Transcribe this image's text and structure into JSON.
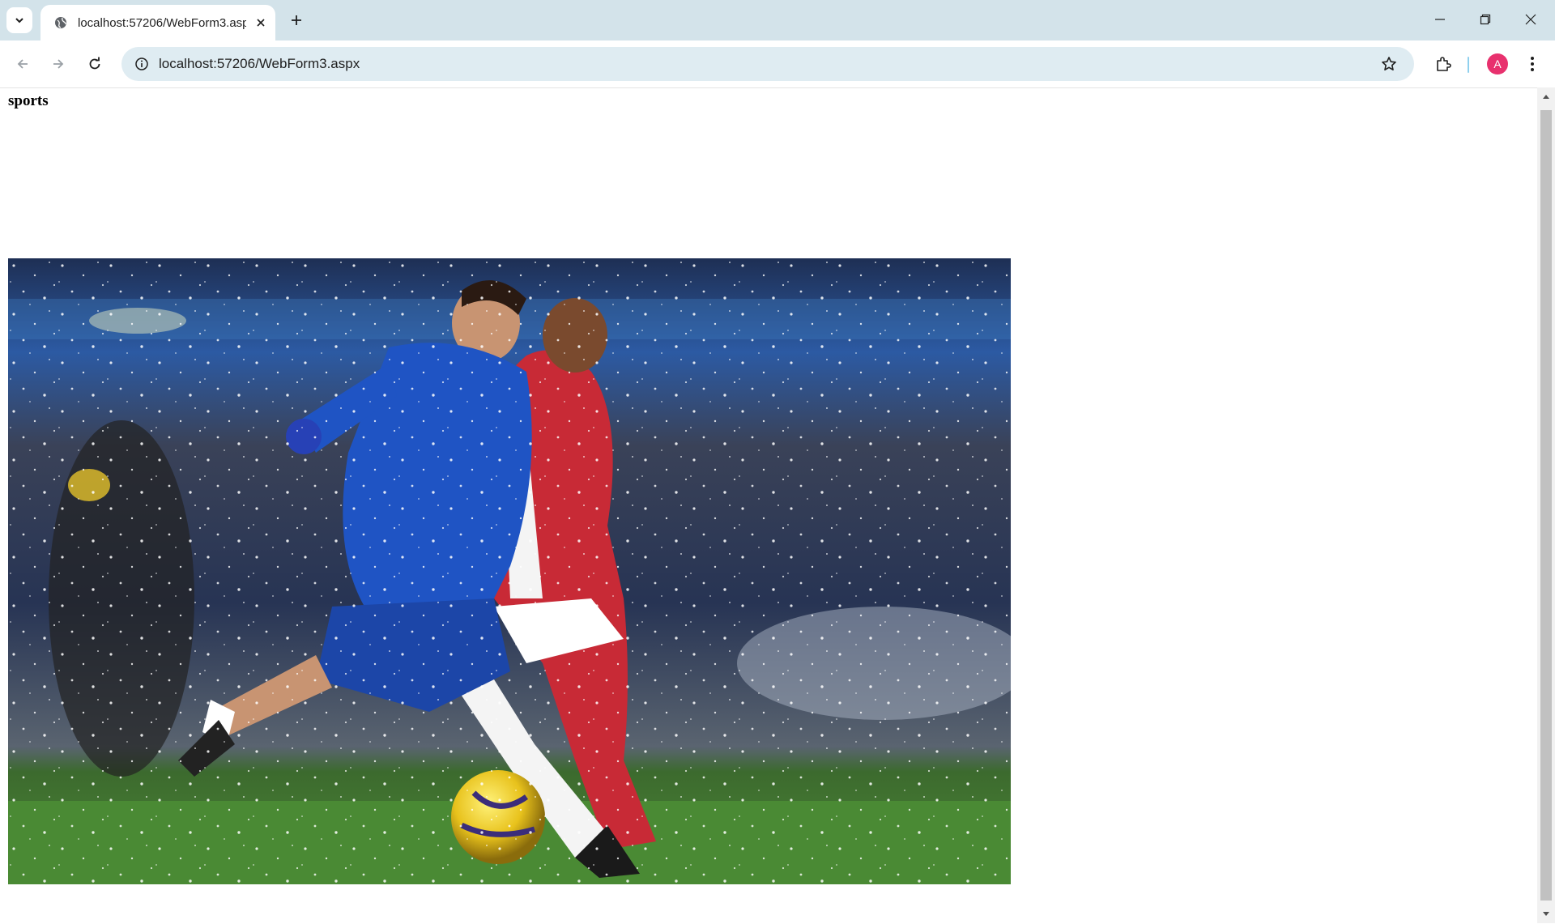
{
  "browser": {
    "tab": {
      "title": "localhost:57206/WebForm3.aspx"
    },
    "address_bar": {
      "url": "localhost:57206/WebForm3.aspx"
    },
    "profile_initial": "A",
    "icons": [
      "tab-search-icon",
      "globe-icon",
      "close-icon",
      "plus-icon",
      "minimize-icon",
      "restore-icon",
      "window-close-icon",
      "back-icon",
      "forward-icon",
      "reload-icon",
      "site-info-icon",
      "star-icon",
      "extensions-icon",
      "menu-icon"
    ]
  },
  "page": {
    "heading": "sports",
    "image": {
      "description_icon": "photo",
      "subject": "football-action-photo"
    }
  },
  "colors": {
    "chrome_bg": "#d3e3ea",
    "omnibox_bg": "#dfecf2",
    "avatar": "#e8316e"
  }
}
